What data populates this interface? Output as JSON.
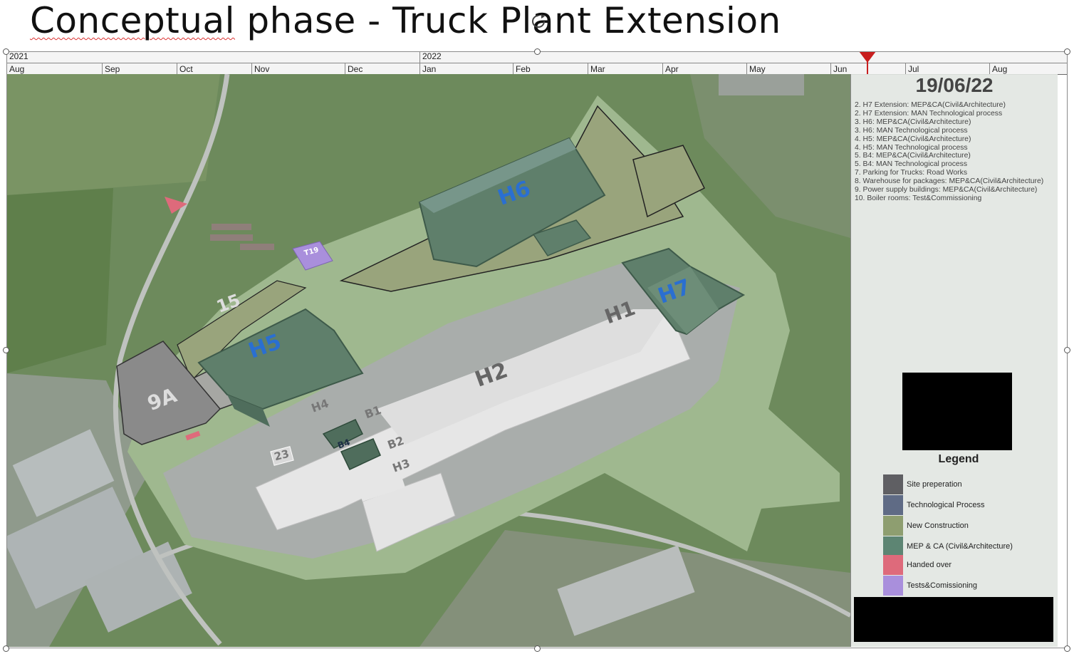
{
  "slide": {
    "title_word1": "Conceptual",
    "title_rest": " phase - Truck Plant Extension"
  },
  "timeline": {
    "years": [
      {
        "label": "2021"
      },
      {
        "label": "2022"
      }
    ],
    "months": [
      "Aug",
      "Sep",
      "Oct",
      "Nov",
      "Dec",
      "Jan",
      "Feb",
      "Mar",
      "Apr",
      "May",
      "Jun",
      "Jul",
      "Aug"
    ],
    "current_marker": "19/06/22"
  },
  "panel": {
    "date": "19/06/22",
    "phases": [
      "2. H7 Extension: MEP&CA(Civil&Architecture)",
      "2. H7 Extension: MAN Technological process",
      "3. H6: MEP&CA(Civil&Architecture)",
      "3. H6: MAN Technological process",
      "4. H5: MEP&CA(Civil&Architecture)",
      "4. H5: MAN Technological process",
      "5. B4: MEP&CA(Civil&Architecture)",
      "5. B4: MAN Technological process",
      "7. Parking for Trucks: Road Works",
      "8. Warehouse for packages: MEP&CA(Civil&Architecture)",
      "9. Power supply buildings: MEP&CA(Civil&Architecture)",
      "10. Boiler rooms: Test&Commissioning"
    ]
  },
  "legend": {
    "title": "Legend",
    "items": [
      {
        "label": "Site preperation",
        "color": "#5f5f63"
      },
      {
        "label": "Technological Process",
        "color": "#5f6b85"
      },
      {
        "label": "New Construction",
        "color": "#8e9e70"
      },
      {
        "label": "MEP & CA (Civil&Architecture)",
        "color": "#5d8573"
      },
      {
        "label": "Handed over",
        "color": "#de6a7b"
      },
      {
        "label": "Tests&Comissioning",
        "color": "#a98fdc"
      }
    ]
  },
  "buildings": {
    "h6": "H6",
    "h7": "H7",
    "h5": "H5",
    "h1": "H1",
    "h2": "H2",
    "h3": "H3",
    "h4": "H4",
    "b1": "B1",
    "b2": "B2",
    "b4": "B4",
    "t19": "T19",
    "l15": "15",
    "l9a": "9A",
    "l23": "23"
  },
  "colors": {
    "accent_marker": "#c81e1e",
    "building_label_blue": "#2a6fd1"
  }
}
